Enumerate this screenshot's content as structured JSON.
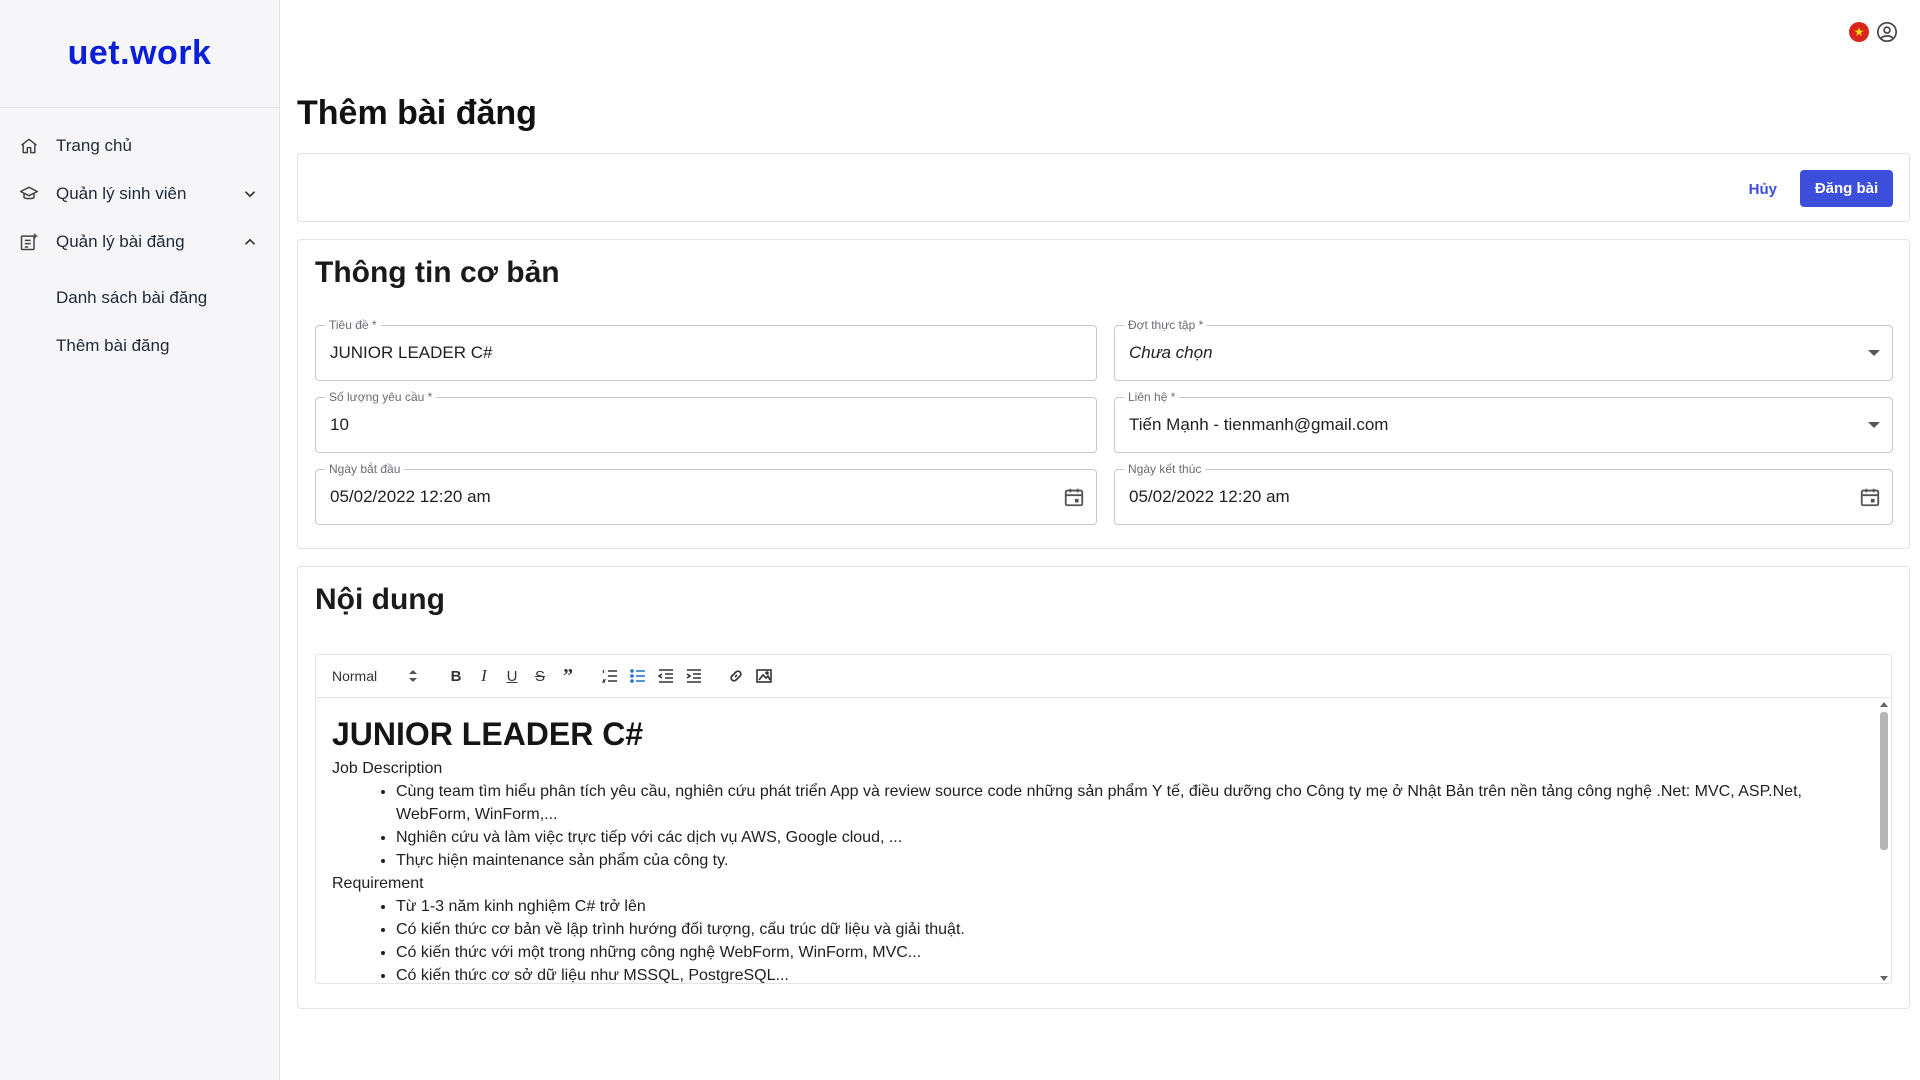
{
  "brand": "uet.work",
  "sidebar": {
    "items": [
      {
        "label": "Trang chủ"
      },
      {
        "label": "Quản lý sinh viên"
      },
      {
        "label": "Quản lý bài đăng"
      }
    ],
    "subitems": [
      {
        "label": "Danh sách bài đăng"
      },
      {
        "label": "Thêm bài đăng"
      }
    ]
  },
  "header": {
    "language_flag": "★"
  },
  "page": {
    "title": "Thêm bài đăng"
  },
  "actions": {
    "cancel_label": "Hủy",
    "post_label": "Đăng bài"
  },
  "basic_info": {
    "title": "Thông tin cơ bản",
    "fields": {
      "title": {
        "label": "Tiêu đề *",
        "value": "JUNIOR LEADER C#"
      },
      "term": {
        "label": "Đợt thực tập *",
        "value": "Chưa chọn"
      },
      "quantity": {
        "label": "Số lượng yêu cầu *",
        "value": "10"
      },
      "contact": {
        "label": "Liên hệ *",
        "value": "Tiến Mạnh - tienmanh@gmail.com"
      },
      "start_date": {
        "label": "Ngày bắt đầu",
        "value": "05/02/2022 12:20 am"
      },
      "end_date": {
        "label": "Ngày kết thúc",
        "value": "05/02/2022 12:20 am"
      }
    }
  },
  "content": {
    "title": "Nội dung",
    "toolbar": {
      "format_label": "Normal"
    },
    "body": {
      "heading": "JUNIOR LEADER C#",
      "section1": "Job Description",
      "list1": [
        "Cùng team tìm hiểu phân tích yêu cầu, nghiên cứu phát triển App và review source code những sản phẩm Y tế, điều dưỡng cho Công ty mẹ ở Nhật Bản trên nền tảng công nghệ .Net: MVC, ASP.Net, WebForm, WinForm,...",
        "Nghiên cứu và làm việc trực tiếp với các dịch vụ AWS, Google cloud, ...",
        "Thực hiện maintenance sản phẩm của công ty."
      ],
      "section2": "Requirement",
      "list2": [
        "Từ 1-3 năm kinh nghiệm C# trở lên",
        "Có kiến thức cơ bản về lập trình hướng đối tượng, cấu trúc dữ liệu và giải thuật.",
        "Có kiến thức với một trong những công nghệ WebForm, WinForm, MVC...",
        "Có kiến thức cơ sở dữ liệu như MSSQL, PostgreSQL..."
      ]
    }
  },
  "colors": {
    "brand": "#0b1fd6",
    "primary": "#3b4fdb",
    "flag_red": "#da251d"
  }
}
